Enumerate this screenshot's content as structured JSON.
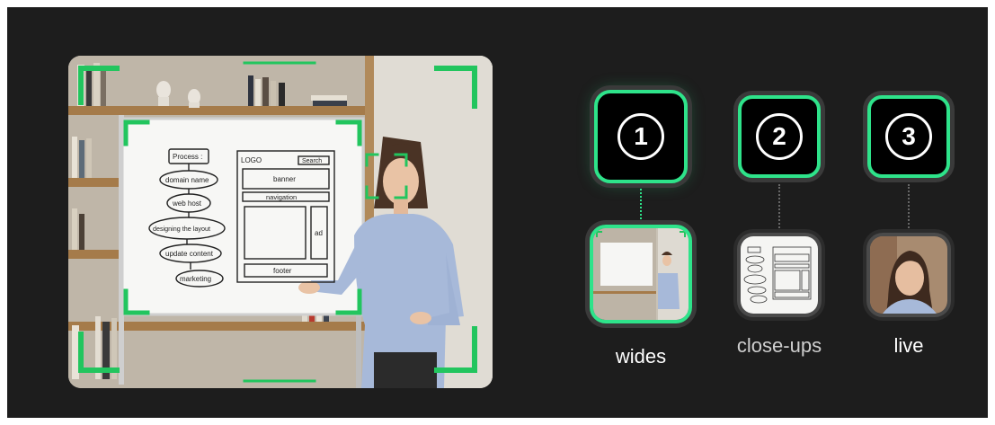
{
  "whiteboard": {
    "process_title": "Process :",
    "steps": [
      "domain name",
      "web host",
      "designing the layout",
      "update content",
      "marketing"
    ],
    "wireframe": {
      "logo": "LOGO",
      "search": "Search",
      "banner": "banner",
      "navigation": "navigation",
      "ad": "ad",
      "footer": "footer"
    }
  },
  "shots": [
    {
      "number": "1",
      "label": "wides",
      "active": true
    },
    {
      "number": "2",
      "label": "close-ups",
      "active": false
    },
    {
      "number": "3",
      "label": "live",
      "active": false
    }
  ],
  "colors": {
    "accent": "#2ee38a",
    "background": "#1d1d1d"
  }
}
